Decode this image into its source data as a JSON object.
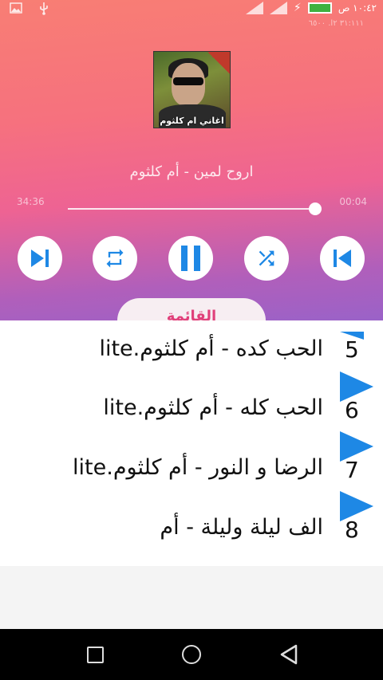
{
  "status_bar": {
    "time": "١٠:٤٢ ص",
    "battery_level": 0.92,
    "notification_text": "٣١:١١١ ٢ا. ٦٥٠٠"
  },
  "player": {
    "album_cover_text": "اغاني ام كلثوم",
    "song_title": "اروح لمين - أم كلثوم",
    "time_elapsed": "00:04",
    "time_total": "34:36",
    "progress": 0.99,
    "controls": {
      "next": "skip-next-icon",
      "repeat": "repeat-icon",
      "pause": "pause-icon",
      "shuffle": "shuffle-icon",
      "previous": "skip-previous-icon"
    },
    "playlist_tab_label": "القائمة"
  },
  "playlist": [
    {
      "number": "5",
      "title": "الحب كده - أم كلثوم.lite"
    },
    {
      "number": "6",
      "title": "الحب كله - أم كلثوم.lite"
    },
    {
      "number": "7",
      "title": "الرضا و النور - أم كلثوم.lite"
    },
    {
      "number": "8",
      "title": "الف ليلة وليلة - أم"
    }
  ],
  "colors": {
    "accent": "#1e88e5",
    "control_icon": "#1e88e5",
    "gradient_top": "#f87e74",
    "gradient_bottom": "#9a62c8"
  }
}
